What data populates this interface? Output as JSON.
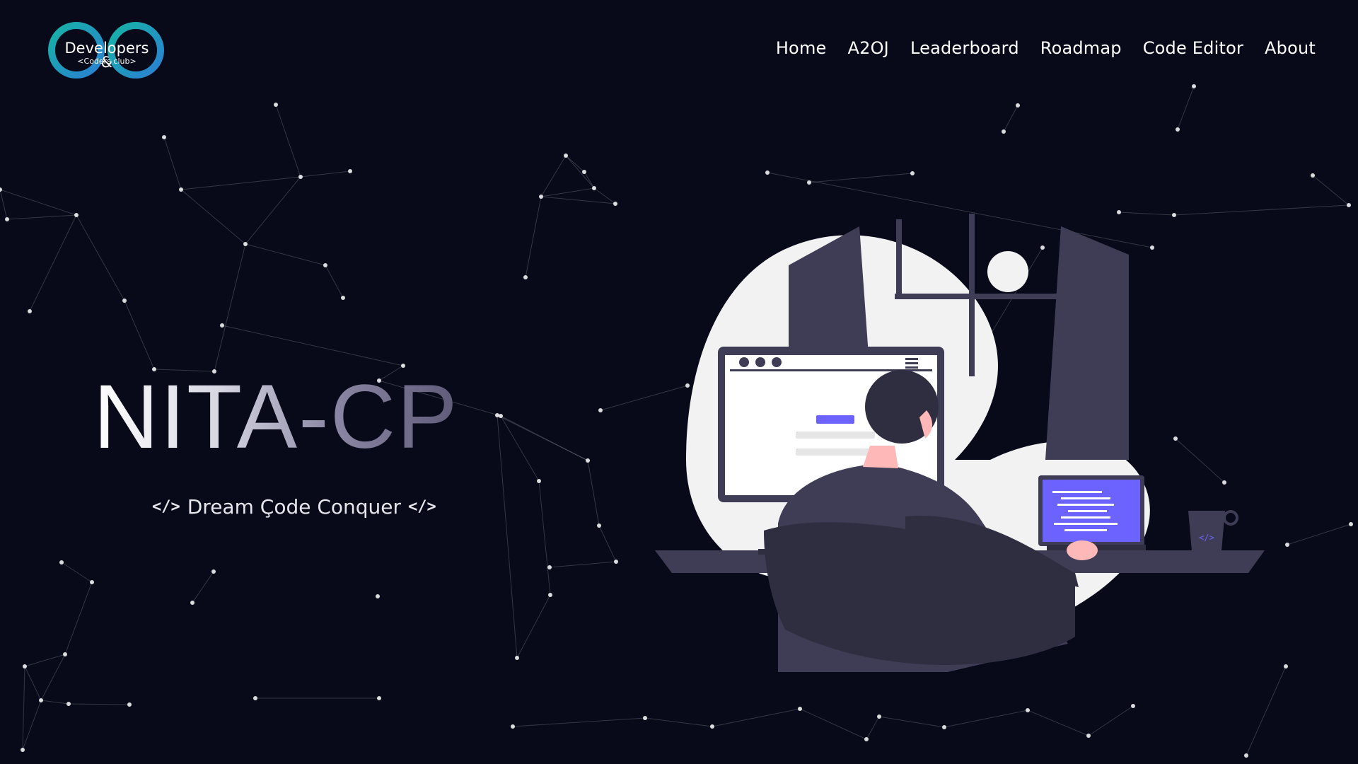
{
  "brand": {
    "logo_text": "Developers &",
    "logo_subtext": "<Coders club>",
    "colors": {
      "teal": "#1aa9a0",
      "blue": "#2b7fd3"
    }
  },
  "nav": {
    "items": [
      {
        "label": "Home"
      },
      {
        "label": "A2OJ"
      },
      {
        "label": "Leaderboard"
      },
      {
        "label": "Roadmap"
      },
      {
        "label": "Code Editor"
      },
      {
        "label": "About"
      }
    ]
  },
  "hero": {
    "title": "NITA-CP",
    "tagline": "Dream Çode Conquer",
    "tagline_icon_left": "</>",
    "tagline_icon_right": "</>"
  },
  "theme": {
    "background": "#080a1a",
    "accent": "#6c63ff",
    "illustration_dark": "#3f3d56",
    "illustration_light": "#f2f2f2"
  }
}
